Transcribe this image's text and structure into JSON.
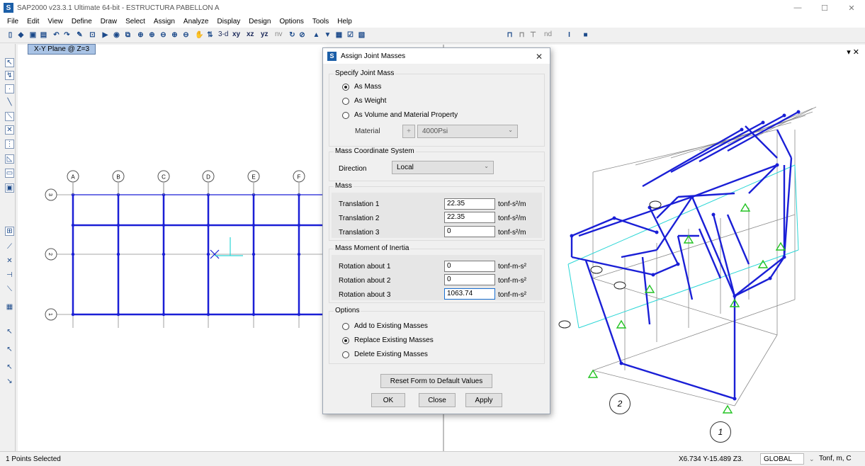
{
  "window": {
    "app_icon_letter": "S",
    "title": "SAP2000 v23.3.1 Ultimate 64-bit - ESTRUCTURA PABELLON A",
    "minimize": "—",
    "maximize": "☐",
    "close": "✕"
  },
  "menu": {
    "items": [
      "File",
      "Edit",
      "View",
      "Define",
      "Draw",
      "Select",
      "Assign",
      "Analyze",
      "Display",
      "Design",
      "Options",
      "Tools",
      "Help"
    ]
  },
  "toolbar": {
    "view_3d": "3-d",
    "view_xy": "xy",
    "view_xz": "xz",
    "view_yz": "yz",
    "view_nv": "nv",
    "nd_label": "nd"
  },
  "left_view": {
    "tab_label": "X-Y Plane @ Z=3",
    "column_labels": [
      "A",
      "B",
      "C",
      "D",
      "E",
      "F"
    ],
    "row_labels": [
      "3",
      "2",
      "1"
    ]
  },
  "right_view": {
    "pane_close": "▾ ✕",
    "bubble_labels": [
      "2",
      "1"
    ]
  },
  "dialog": {
    "icon_letter": "S",
    "title": "Assign Joint Masses",
    "close": "✕",
    "specify": {
      "label": "Specify Joint Mass",
      "options": [
        "As Mass",
        "As Weight",
        "As Volume and Material Property"
      ],
      "selected": "As Mass",
      "material_label": "Material",
      "material_plus": "+",
      "material_value": "4000Psi"
    },
    "coord": {
      "label": "Mass Coordinate System",
      "direction_label": "Direction",
      "direction_value": "Local"
    },
    "mass": {
      "label": "Mass",
      "rows": [
        {
          "label": "Translation 1",
          "value": "22.35",
          "unit": "tonf-s²/m"
        },
        {
          "label": "Translation 2",
          "value": "22.35",
          "unit": "tonf-s²/m"
        },
        {
          "label": "Translation 3",
          "value": "0",
          "unit": "tonf-s²/m"
        }
      ]
    },
    "inertia": {
      "label": "Mass Moment of Inertia",
      "rows": [
        {
          "label": "Rotation about 1",
          "value": "0",
          "unit": "tonf-m-s²"
        },
        {
          "label": "Rotation about 2",
          "value": "0",
          "unit": "tonf-m-s²"
        },
        {
          "label": "Rotation about 3",
          "value": "1063.74",
          "unit": "tonf-m-s²"
        }
      ]
    },
    "options": {
      "label": "Options",
      "items": [
        "Add to Existing Masses",
        "Replace Existing Masses",
        "Delete Existing Masses"
      ],
      "selected": "Replace Existing Masses"
    },
    "buttons": {
      "reset": "Reset Form to Default Values",
      "ok": "OK",
      "close": "Close",
      "apply": "Apply"
    }
  },
  "status": {
    "selection": "1 Points Selected",
    "coords": "X6.734  Y-15.489  Z3.",
    "coord_system": "GLOBAL",
    "units": "Tonf, m, C"
  },
  "colors": {
    "frame": "#1a1fd6",
    "support": "#22c322",
    "grid": "#8a8a8a",
    "cyan": "#2bd6d6",
    "accent": "#1c5fa8"
  }
}
